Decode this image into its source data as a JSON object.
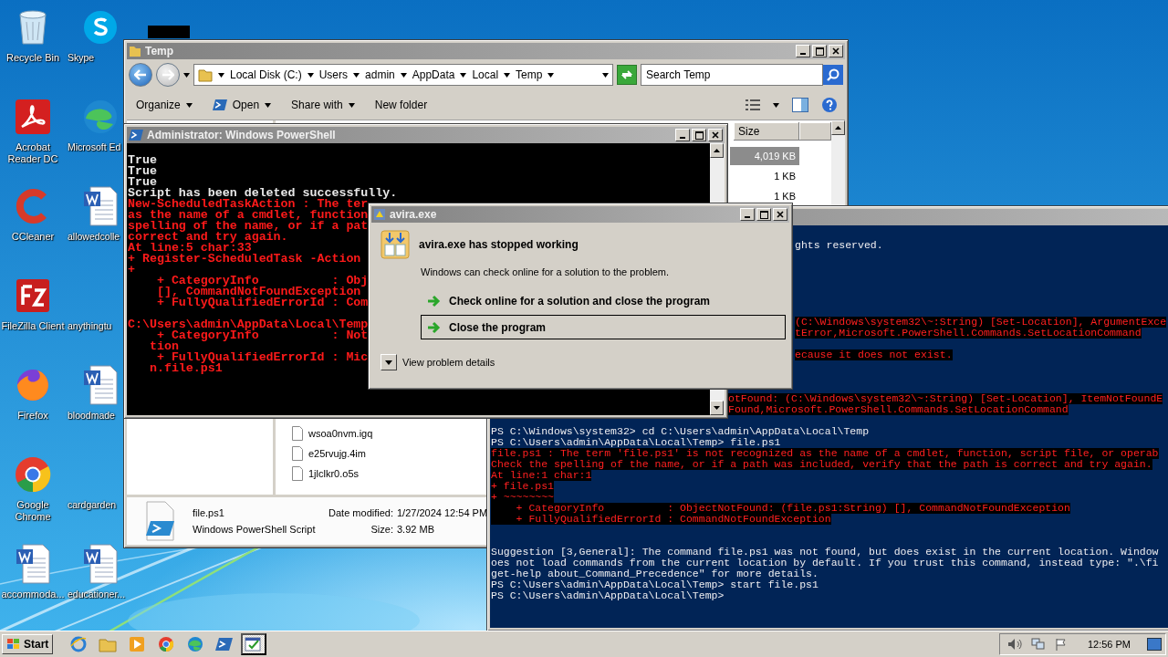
{
  "desktop_icons": [
    {
      "label": "Recycle Bin",
      "kind": "recycle"
    },
    {
      "label": "Skype",
      "kind": "skype"
    },
    {
      "label": "Acrobat Reader DC",
      "kind": "pdf"
    },
    {
      "label": "Microsoft Ed",
      "kind": "edge"
    },
    {
      "label": "CCleaner",
      "kind": "ccleaner"
    },
    {
      "label": "allowedcolle",
      "kind": "word"
    },
    {
      "label": "FileZilla Client",
      "kind": "filezilla"
    },
    {
      "label": "anythingtu",
      "kind": "blank"
    },
    {
      "label": "Firefox",
      "kind": "firefox"
    },
    {
      "label": "bloodmade",
      "kind": "word"
    },
    {
      "label": "Google Chrome",
      "kind": "chrome"
    },
    {
      "label": "cardgarden",
      "kind": "blank"
    },
    {
      "label": "accommoda...",
      "kind": "word"
    },
    {
      "label": "educationer...",
      "kind": "word"
    }
  ],
  "explorer": {
    "title": "Temp",
    "breadcrumb": [
      "Local Disk (C:)",
      "Users",
      "admin",
      "AppData",
      "Local",
      "Temp"
    ],
    "search": {
      "placeholder": "Search Temp"
    },
    "toolbar": [
      {
        "label": "Organize",
        "kind": "menu"
      },
      {
        "label": "Open",
        "kind": "open"
      },
      {
        "label": "Share with",
        "kind": "menu"
      },
      {
        "label": "New folder",
        "kind": "plain"
      }
    ],
    "columns": [
      "Size"
    ],
    "size_rows": [
      {
        "size": "4,019 KB",
        "selected": true
      },
      {
        "size": "1 KB",
        "selected": false
      },
      {
        "size": "1 KB",
        "selected": false
      }
    ],
    "name_rows": [
      "wsoa0nvm.igq",
      "e25rvujg.4im",
      "1jlclkr0.o5s"
    ],
    "details": {
      "name": "file.ps1",
      "type": "Windows PowerShell Script",
      "date_label": "Date modified:",
      "date": "1/27/2024 12:54 PM",
      "size_label": "Size:",
      "size": "3.92 MB"
    }
  },
  "blue_console": {
    "blocks": [
      {
        "lines": [
          {
            "text": "ghts reserved.",
            "kind": "output"
          }
        ]
      },
      {
        "lines": [
          {
            "text": "(C:\\Windows\\system32\\~:String) [Set-Location], ArgumentExce",
            "kind": "error"
          },
          {
            "text": "tError,Microsoft.PowerShell.Commands.SetLocationCommand",
            "kind": "error"
          }
        ]
      },
      {
        "lines": [
          {
            "text": "ecause it does not exist.",
            "kind": "error"
          }
        ]
      },
      {
        "lines": [
          {
            "text": "otFound: (C:\\Windows\\system32\\~:String) [Set-Location], ItemNotFoundE",
            "kind": "error"
          },
          {
            "text": "Found,Microsoft.PowerShell.Commands.SetLocationCommand",
            "kind": "error"
          }
        ]
      },
      {
        "lines": [
          {
            "text": "PS C:\\Windows\\system32> cd C:\\Users\\admin\\AppData\\Local\\Temp",
            "kind": "output"
          },
          {
            "text": "PS C:\\Users\\admin\\AppData\\Local\\Temp> file.ps1",
            "kind": "output"
          },
          {
            "text": "file.ps1 : The term 'file.ps1' is not recognized as the name of a cmdlet, function, script file, or operab",
            "kind": "error"
          },
          {
            "text": "Check the spelling of the name, or if a path was included, verify that the path is correct and try again.",
            "kind": "error"
          },
          {
            "text": "At line:1 char:1",
            "kind": "error"
          },
          {
            "text": "+ file.ps1",
            "kind": "error"
          },
          {
            "text": "+ ~~~~~~~~",
            "kind": "error"
          },
          {
            "text": "    + CategoryInfo          : ObjectNotFound: (file.ps1:String) [], CommandNotFoundException",
            "kind": "error"
          },
          {
            "text": "    + FullyQualifiedErrorId : CommandNotFoundException",
            "kind": "error"
          }
        ]
      },
      {
        "lines": [
          {
            "text": "Suggestion [3,General]: The command file.ps1 was not found, but does exist in the current location. Window",
            "kind": "output"
          },
          {
            "text": "oes not load commands from the current location by default. If you trust this command, instead type: \".\\fi",
            "kind": "output"
          },
          {
            "text": "get-help about_Command_Precedence\" for more details.",
            "kind": "output"
          },
          {
            "text": "PS C:\\Users\\admin\\AppData\\Local\\Temp> start file.ps1",
            "kind": "output"
          },
          {
            "text": "PS C:\\Users\\admin\\AppData\\Local\\Temp>",
            "kind": "output"
          }
        ]
      }
    ]
  },
  "black_console": {
    "title": "Administrator: Windows PowerShell",
    "blocks": [
      {
        "lines": [
          {
            "text": "True",
            "kind": "output"
          },
          {
            "text": "True",
            "kind": "output"
          },
          {
            "text": "True",
            "kind": "output"
          },
          {
            "text": "Script has been deleted successfully.",
            "kind": "output"
          },
          {
            "text": "New-ScheduledTaskAction : The ter",
            "kind": "error"
          },
          {
            "text": "as the name of a cmdlet, function",
            "kind": "error"
          },
          {
            "text": "spelling of the name, or if a pat",
            "kind": "error"
          },
          {
            "text": "correct and try again.",
            "kind": "error"
          },
          {
            "text": "At line:5 char:33",
            "kind": "error"
          },
          {
            "text": "+ Register-ScheduledTask -Action",
            "kind": "error"
          },
          {
            "text": "+",
            "kind": "error"
          },
          {
            "text": "    + CategoryInfo          : Obj",
            "kind": "error"
          },
          {
            "text": "    [], CommandNotFoundException",
            "kind": "error"
          },
          {
            "text": "    + FullyQualifiedErrorId : Com",
            "kind": "error"
          }
        ]
      },
      {
        "lines": [
          {
            "text": "C:\\Users\\admin\\AppData\\Local\\Temp",
            "kind": "error"
          },
          {
            "text": "    + CategoryInfo          : Not",
            "kind": "error"
          },
          {
            "text": "   tion",
            "kind": "error"
          },
          {
            "text": "    + FullyQualifiedErrorId : Mic",
            "kind": "error"
          },
          {
            "text": "   n.file.ps1",
            "kind": "error"
          }
        ]
      }
    ]
  },
  "dialog": {
    "title": "avira.exe",
    "heading": "avira.exe has stopped working",
    "message": "Windows can check online for a solution to the problem.",
    "options": [
      {
        "label": "Check online for a solution and close the program",
        "selected": false
      },
      {
        "label": "Close the program",
        "selected": true
      }
    ],
    "details_toggle": "View problem details"
  },
  "taskbar": {
    "start": "Start",
    "apps": [
      {
        "kind": "ie",
        "active": false
      },
      {
        "kind": "folder",
        "active": false
      },
      {
        "kind": "media",
        "active": false
      },
      {
        "kind": "chrome",
        "active": false
      },
      {
        "kind": "edge",
        "active": false
      },
      {
        "kind": "powershell",
        "active": false
      },
      {
        "kind": "report",
        "active": true
      }
    ],
    "clock": "12:56 PM"
  }
}
